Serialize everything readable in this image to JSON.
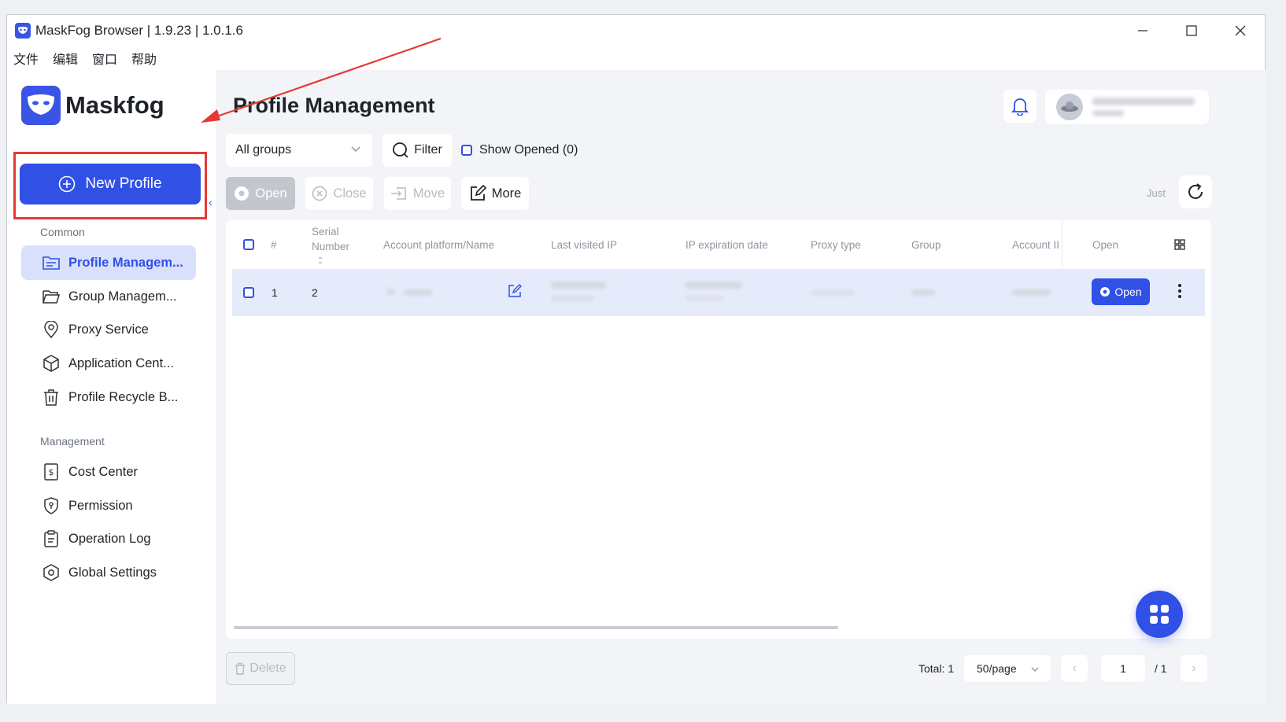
{
  "window": {
    "title": "MaskFog Browser | 1.9.23 | 1.0.1.6",
    "menu": [
      "文件",
      "编辑",
      "窗口",
      "帮助"
    ]
  },
  "brand": {
    "name": "Maskfog",
    "color": "#3050e6"
  },
  "sidebar": {
    "new_profile_label": "New Profile",
    "common_label": "Common",
    "management_label": "Management",
    "common_items": [
      {
        "label": "Profile Managem...",
        "icon": "folder-icon",
        "active": true
      },
      {
        "label": "Group Managem...",
        "icon": "folder-open-icon"
      },
      {
        "label": "Proxy Service",
        "icon": "location-pin-icon"
      },
      {
        "label": "Application Cent...",
        "icon": "cube-icon"
      },
      {
        "label": "Profile Recycle B...",
        "icon": "trash-icon"
      }
    ],
    "management_items": [
      {
        "label": "Cost Center",
        "icon": "receipt-icon"
      },
      {
        "label": "Permission",
        "icon": "shield-icon"
      },
      {
        "label": "Operation Log",
        "icon": "clipboard-icon"
      },
      {
        "label": "Global Settings",
        "icon": "settings-hex-icon"
      }
    ]
  },
  "main": {
    "title": "Profile Management",
    "group_select": "All groups",
    "filter_label": "Filter",
    "show_opened_label": "Show Opened (0)",
    "toolbar": {
      "open": "Open",
      "close": "Close",
      "move": "Move",
      "more": "More"
    },
    "refresh_hint": "Just",
    "table": {
      "columns": [
        "#",
        "Serial Number",
        "Account platform/Name",
        "Last visited IP",
        "IP expiration date",
        "Proxy type",
        "Group",
        "Account II",
        "Open"
      ],
      "rows": [
        {
          "index": "1",
          "serial": "2",
          "open_label": "Open"
        }
      ]
    },
    "footer": {
      "delete_label": "Delete",
      "total_label": "Total: 1",
      "page_size": "50/page",
      "current_page": "1",
      "page_total": "/ 1"
    }
  },
  "colors": {
    "accent": "#3050e6",
    "highlight_frame": "#e53935",
    "row_selected": "#e6ebfb"
  }
}
